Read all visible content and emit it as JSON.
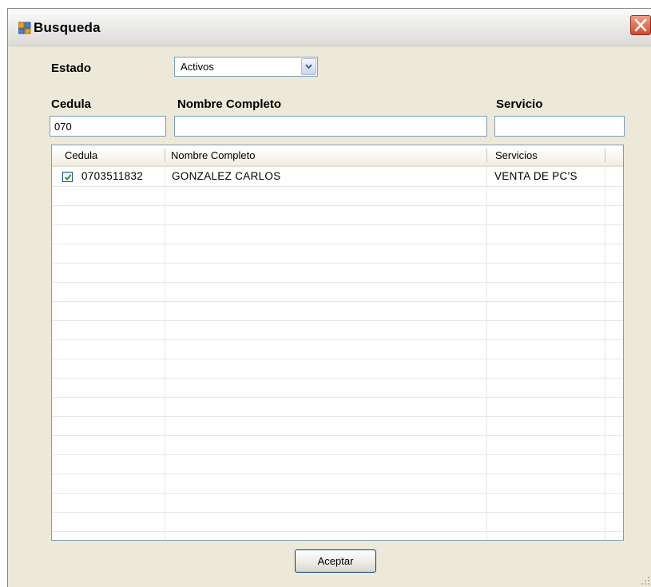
{
  "window": {
    "title": "Busqueda",
    "app_icon": "form-window-icon",
    "close_icon": "close-icon",
    "accent_close": "#d54a2c"
  },
  "filters": {
    "estado_label": "Estado",
    "estado_value": "Activos",
    "cedula_label": "Cedula",
    "cedula_value": "070",
    "nombre_label": "Nombre Completo",
    "nombre_value": "",
    "servicio_label": "Servicio",
    "servicio_value": ""
  },
  "grid": {
    "columns": [
      "Cedula",
      "Nombre Completo",
      "Servicios"
    ],
    "rows": [
      {
        "checked": true,
        "cedula": "0703511832",
        "nombre": "GONZALEZ  CARLOS",
        "servicio": "VENTA DE PC'S"
      }
    ]
  },
  "actions": {
    "accept_label": "Aceptar"
  }
}
